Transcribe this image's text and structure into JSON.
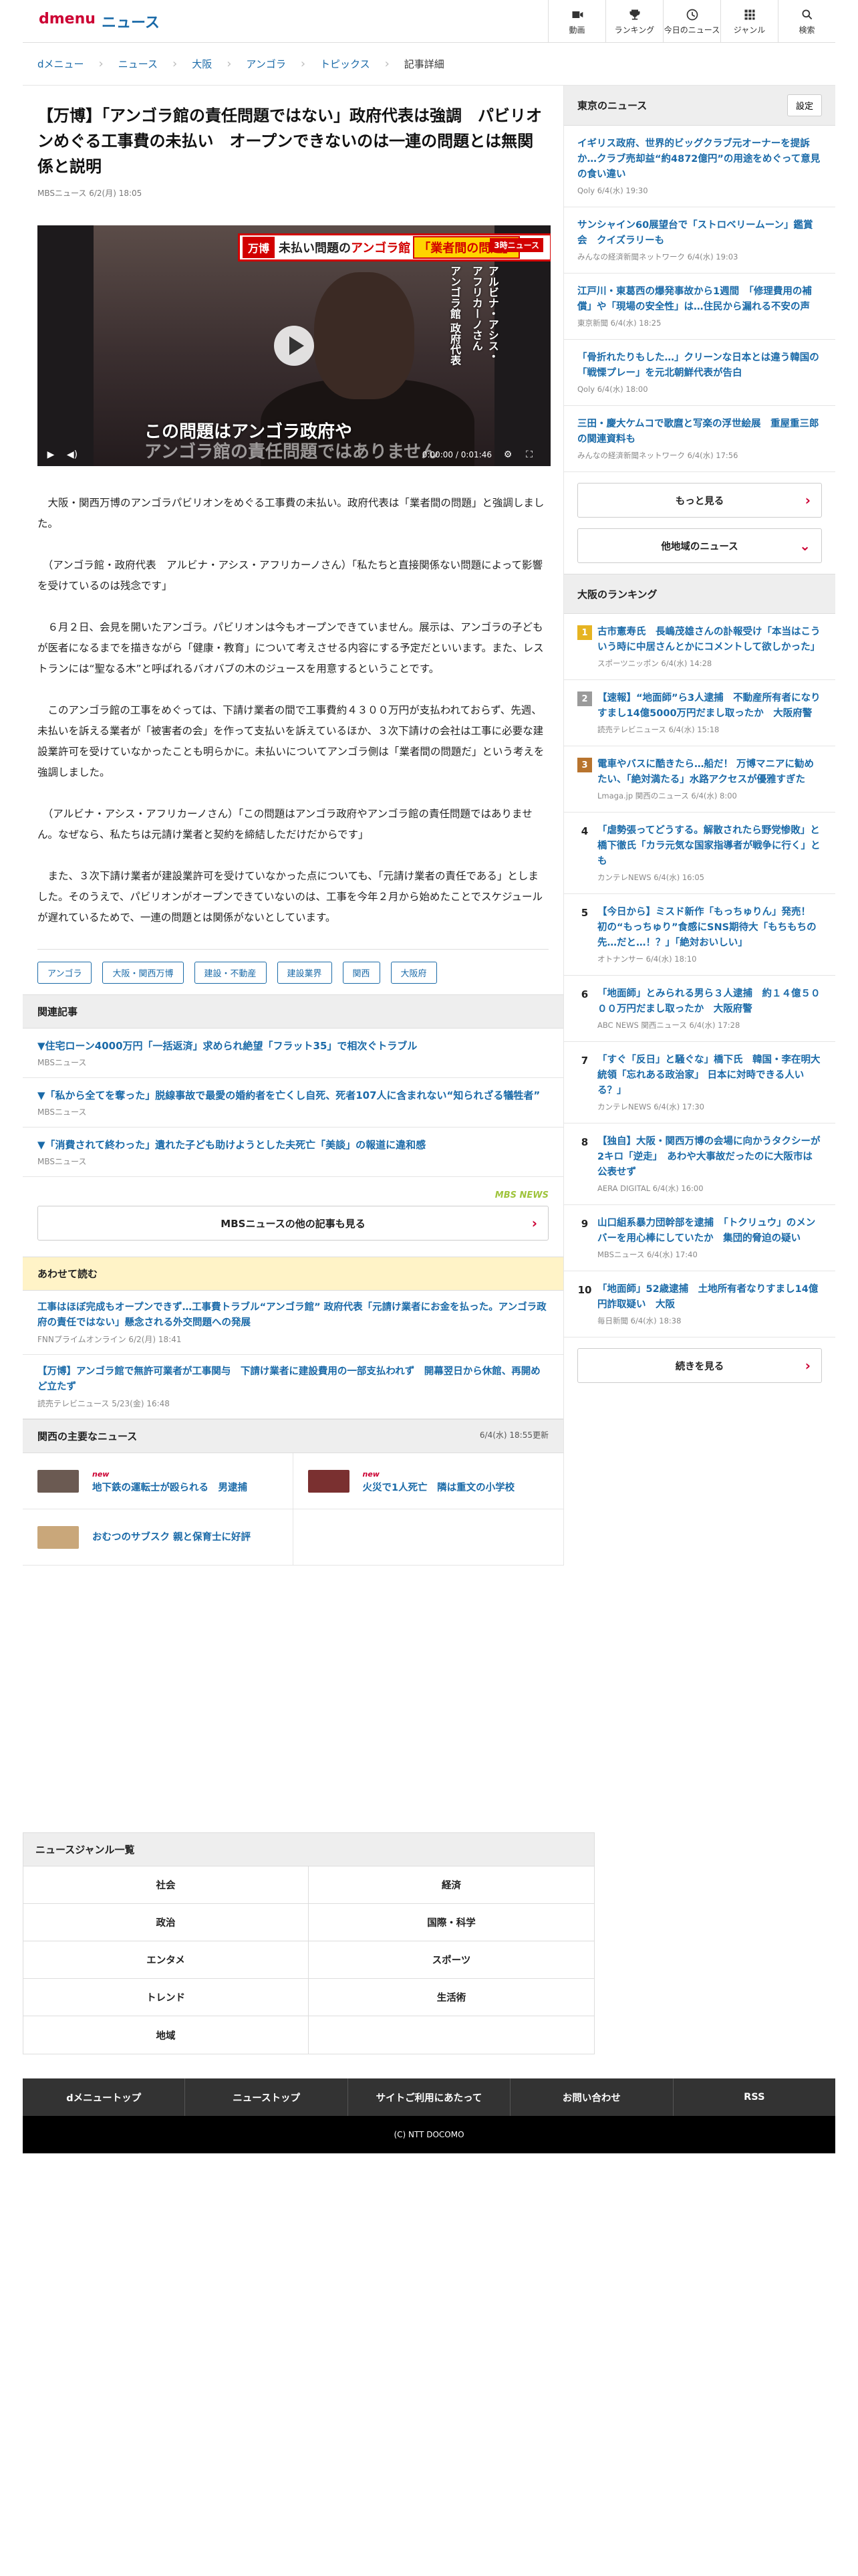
{
  "header": {
    "logo": "dmenu",
    "service": "ニュース",
    "nav": [
      {
        "label": "動画",
        "icon": "video-icon"
      },
      {
        "label": "ランキング",
        "icon": "trophy-icon"
      },
      {
        "label": "今日のニュース",
        "icon": "clock-icon"
      },
      {
        "label": "ジャンル",
        "icon": "grid-icon"
      },
      {
        "label": "検索",
        "icon": "search-icon"
      }
    ]
  },
  "breadcrumb": [
    "dメニュー",
    "ニュース",
    "大阪",
    "アンゴラ",
    "トピックス",
    "記事詳細"
  ],
  "article": {
    "title": "【万博】「アンゴラ館の責任問題ではない」政府代表は強調　パビリオンめぐる工事費の未払い　オープンできないのは一連の問題とは無関係と説明",
    "meta": "MBSニュース 6/2(月) 18:05",
    "video": {
      "banner_tag": "万博",
      "banner_text": "未払い問題の",
      "banner_red": "アンゴラ館",
      "banner_box": "「業者間の問題」",
      "banner_badge": "3時ニュース",
      "vertical_label_1": "アンゴラ館 政府代表",
      "vertical_label_2": "アルビナ・アシス・アフリカーノさん",
      "caption_1": "この問題はアンゴラ政府や",
      "caption_2": "アンゴラ館の責任問題ではありません",
      "time": "0:00:00 / 0:01:46"
    },
    "paragraphs": [
      "　大阪・関西万博のアンゴラパビリオンをめぐる工事費の未払い。政府代表は「業者間の問題」と強調しました。",
      "　（アンゴラ館・政府代表　アルビナ・アシス・アフリカーノさん）「私たちと直接関係ない問題によって影響を受けているのは残念です」",
      "　６月２日、会見を開いたアンゴラ。パビリオンは今もオープンできていません。展示は、アンゴラの子どもが医者になるまでを描きながら「健康・教育」について考えさせる内容にする予定だといいます。また、レストランには“聖なる木”と呼ばれるバオバブの木のジュースを用意するということです。",
      "　このアンゴラ館の工事をめぐっては、下請け業者の間で工事費約４３００万円が支払われておらず、先週、未払いを訴える業者が「被害者の会」を作って支払いを訴えているほか、３次下請けの会社は工事に必要な建設業許可を受けていなかったことも明らかに。未払いについてアンゴラ側は「業者間の問題だ」という考えを強調しました。",
      "　（アルビナ・アシス・アフリカーノさん）「この問題はアンゴラ政府やアンゴラ館の責任問題ではありません。なぜなら、私たちは元請け業者と契約を締結しただけだからです」",
      "　また、３次下請け業者が建設業許可を受けていなかった点についても、「元請け業者の責任である」としました。そのうえで、パビリオンがオープンできていないのは、工事を今年２月から始めたことでスケジュールが遅れているためで、一連の問題とは関係がないとしています。"
    ],
    "tags": [
      "アンゴラ",
      "大阪・関西万博",
      "建設・不動産",
      "建設業界",
      "関西",
      "大阪府"
    ]
  },
  "related": {
    "heading": "関連記事",
    "items": [
      {
        "title": "▼住宅ローン4000万円「一括返済」求められ絶望「フラット35」で相次ぐトラブル",
        "source": "MBSニュース"
      },
      {
        "title": "▼「私から全てを奪った」脱線事故で最愛の婚約者を亡くし自死、死者107人に含まれない“知られざる犠牲者”",
        "source": "MBSニュース"
      },
      {
        "title": "▼「消費されて終わった」遺れた子ども助けようとした夫死亡「美談」の報道に違和感",
        "source": "MBSニュース"
      }
    ],
    "logo": "MBS NEWS",
    "more": "MBSニュースの他の記事も見る"
  },
  "also": {
    "heading": "あわせて読む",
    "items": [
      {
        "title": "工事はほぼ完成もオープンできず…工事費トラブル“アンゴラ館” 政府代表「元請け業者にお金を払った。アンゴラ政府の責任ではない」懸念される外交問題への発展",
        "source": "FNNプライムオンライン 6/2(月) 18:41"
      },
      {
        "title": "【万博】アンゴラ館で無許可業者が工事関与　下請け業者に建設費用の一部支払われず　開幕翌日から休館、再開めど立たず",
        "source": "読売テレビニュース 5/23(金) 16:48"
      }
    ]
  },
  "kansai": {
    "heading": "関西の主要なニュース",
    "updated": "6/4(水) 18:55更新",
    "items": [
      {
        "new": "new",
        "title": "地下鉄の運転士が殴られる　男逮捕",
        "color": "#6b5a52"
      },
      {
        "new": "new",
        "title": "火災で1人死亡　隣は重文の小学校",
        "color": "#7a3030"
      },
      {
        "new": "",
        "title": "おむつのサブスク 親と保育士に好評",
        "color": "#c9a77a"
      }
    ]
  },
  "tokyo_news": {
    "heading": "東京のニュース",
    "setting": "設定",
    "items": [
      {
        "title": "イギリス政府、世界的ビッグクラブ元オーナーを提訴か…クラブ売却益“約4872億円”の用途をめぐって意見の食い違い",
        "source": "Qoly 6/4(水) 19:30"
      },
      {
        "title": "サンシャイン60展望台で「ストロベリームーン」鑑賞会　クイズラリーも",
        "source": "みんなの経済新聞ネットワーク 6/4(水) 19:03"
      },
      {
        "title": "江戸川・東葛西の爆発事故から1週間　「修理費用の補償」や「現場の安全性」は…住民から漏れる不安の声",
        "source": "東京新聞 6/4(水) 18:25"
      },
      {
        "title": "「骨折れたりもした…」クリーンな日本とは違う韓国の「戦慄プレー」を元北朝鮮代表が告白",
        "source": "Qoly 6/4(水) 18:00"
      },
      {
        "title": "三田・慶大ケムコで歌麿と写楽の浮世絵展　重屋重三郎の関連資料も",
        "source": "みんなの経済新聞ネットワーク 6/4(水) 17:56"
      }
    ],
    "more": "もっと見る",
    "other": "他地域のニュース"
  },
  "ranking": {
    "heading": "大阪のランキング",
    "items": [
      {
        "rank": "1",
        "color": "#e6b422",
        "title": "古市憲寿氏　長嶋茂雄さんの訃報受け「本当はこういう時に中居さんとかにコメントして欲しかった」",
        "source": "スポーツニッポン 6/4(水) 14:28"
      },
      {
        "rank": "2",
        "color": "#9a9a9a",
        "title": "【速報】“地面師”ら3人逮捕　不動産所有者になりすまし14億5000万円だまし取ったか　大阪府警",
        "source": "読売テレビニュース 6/4(水) 15:18"
      },
      {
        "rank": "3",
        "color": "#b8742e",
        "title": "電車やバスに酷きたら…船だ！ 万博マニアに勧めたい、「絶対満たる」水路アクセスが優雅すぎた",
        "source": "Lmaga.jp 関西のニュース 6/4(水) 8:00"
      },
      {
        "rank": "4",
        "color": "",
        "title": "「虐勢張ってどうする。解散されたら野党惨敗」と橋下徹氏「カラ元気な国家指導者が戦争に行く」とも",
        "source": "カンテレNEWS 6/4(水) 16:05"
      },
      {
        "rank": "5",
        "color": "",
        "title": "【今日から】ミスド新作「もっちゅりん」発売！　初の“もっちゅり”食感にSNS期待大「もちもちの先…だと…！？」「絶対おいしい」",
        "source": "オトナンサー 6/4(水) 18:10"
      },
      {
        "rank": "6",
        "color": "",
        "title": "「地面師」とみられる男ら３人逮捕　約１４億５０００万円だまし取ったか　大阪府警",
        "source": "ABC NEWS 関西ニュース 6/4(水) 17:28"
      },
      {
        "rank": "7",
        "color": "",
        "title": "「すぐ「反日」と騒ぐな」橋下氏　韓国・李在明大統領「忘れある政治家」 日本に対時できる人いる？」",
        "source": "カンテレNEWS 6/4(水) 17:30"
      },
      {
        "rank": "8",
        "color": "",
        "title": "【独自】大阪・関西万博の会場に向かうタクシーが2キロ「逆走」　あわや大事故だったのに大阪市は公表せず",
        "source": "AERA DIGITAL 6/4(水) 16:00"
      },
      {
        "rank": "9",
        "color": "",
        "title": "山口組系暴力団幹部を逮捕　「トクリュウ」のメンバーを用心棒にしていたか　集団的脅迫の疑い",
        "source": "MBSニュース 6/4(水) 17:40"
      },
      {
        "rank": "10",
        "color": "",
        "title": "「地面師」52歳逮捕　土地所有者なりすまし14億円詐取疑い　大阪",
        "source": "毎日新聞 6/4(水) 18:38"
      }
    ],
    "more": "続きを見る"
  },
  "genre": {
    "heading": "ニュースジャンル一覧",
    "items": [
      "社会",
      "経済",
      "政治",
      "国際・科学",
      "エンタメ",
      "スポーツ",
      "トレンド",
      "生活術",
      "地域"
    ]
  },
  "footer": {
    "nav": [
      "dメニュートップ",
      "ニューストップ",
      "サイトご利用にあたって",
      "お問い合わせ",
      "RSS"
    ],
    "copyright": "(C) NTT DOCOMO"
  }
}
